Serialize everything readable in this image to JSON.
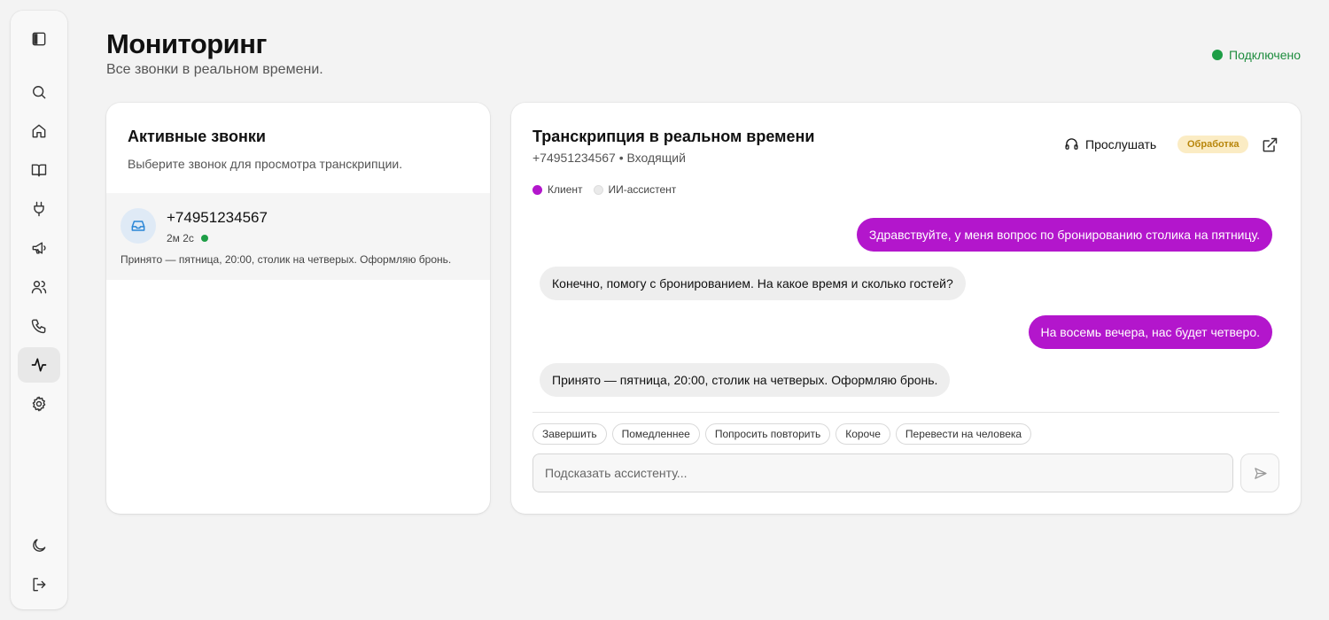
{
  "header": {
    "title": "Мониторинг",
    "subtitle": "Все звонки в реальном времени.",
    "connection_status": "Подключено",
    "connection_color": "#1e9e46"
  },
  "sidebar": {
    "items": [
      {
        "id": "toggle",
        "icon": "panel-toggle-icon"
      },
      {
        "id": "search",
        "icon": "search-icon"
      },
      {
        "id": "home",
        "icon": "home-icon"
      },
      {
        "id": "knowledge",
        "icon": "book-icon"
      },
      {
        "id": "integrations",
        "icon": "plug-icon"
      },
      {
        "id": "campaigns",
        "icon": "megaphone-icon"
      },
      {
        "id": "contacts",
        "icon": "users-icon"
      },
      {
        "id": "calls",
        "icon": "phone-icon"
      },
      {
        "id": "monitoring",
        "icon": "activity-icon",
        "active": true
      },
      {
        "id": "settings",
        "icon": "gear-icon"
      },
      {
        "id": "theme",
        "icon": "moon-icon"
      },
      {
        "id": "logout",
        "icon": "logout-icon"
      }
    ]
  },
  "active_calls": {
    "title": "Активные звонки",
    "subtitle": "Выберите звонок для просмотра транскрипции.",
    "calls": [
      {
        "phone": "+74951234567",
        "duration": "2м 2с",
        "preview": "Принято — пятница, 20:00, столик на четверых. Оформляю бронь.",
        "icon": "inbox-icon"
      }
    ]
  },
  "transcript": {
    "title": "Транскрипция в реальном времени",
    "subtitle": "+74951234567 • Входящий",
    "listen_label": "Прослушать",
    "status_badge": "Обработка",
    "legend": {
      "client": "Клиент",
      "assistant": "ИИ-ассистент",
      "client_color": "#b316cc",
      "assistant_color": "#eeeeee"
    },
    "messages": [
      {
        "role": "client",
        "text": "Здравствуйте, у меня вопрос по бронированию столика на пятницу."
      },
      {
        "role": "assistant",
        "text": "Конечно, помогу с бронированием. На какое время и сколько гостей?"
      },
      {
        "role": "client",
        "text": "На восемь вечера, нас будет четверо."
      },
      {
        "role": "assistant",
        "text": "Принято — пятница, 20:00, столик на четверых. Оформляю бронь."
      }
    ],
    "quick_actions": [
      "Завершить",
      "Помедленнее",
      "Попросить повторить",
      "Короче",
      "Перевести на человека"
    ],
    "hint_placeholder": "Подсказать ассистенту..."
  }
}
